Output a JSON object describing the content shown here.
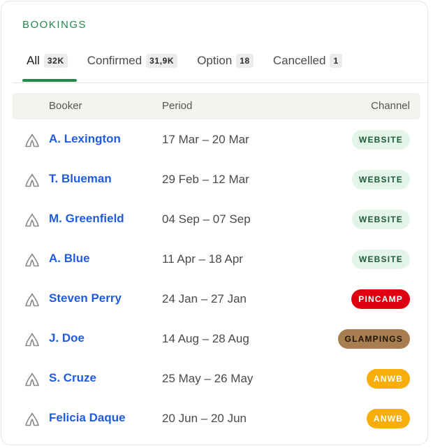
{
  "card": {
    "title": "BOOKINGS"
  },
  "tabs": [
    {
      "label": "All",
      "count": "32K",
      "active": true
    },
    {
      "label": "Confirmed",
      "count": "31,9K",
      "active": false
    },
    {
      "label": "Option",
      "count": "18",
      "active": false
    },
    {
      "label": "Cancelled",
      "count": "1",
      "active": false
    }
  ],
  "table": {
    "headers": {
      "booker": "Booker",
      "period": "Period",
      "channel": "Channel"
    },
    "rows": [
      {
        "icon": "tent-icon",
        "booker": "A. Lexington",
        "period": "17 Mar – 20 Mar",
        "channel": "WEBSITE"
      },
      {
        "icon": "tent-icon",
        "booker": "T. Blueman",
        "period": "29 Feb – 12 Mar",
        "channel": "WEBSITE"
      },
      {
        "icon": "tent-icon",
        "booker": "M. Greenfield",
        "period": "04 Sep – 07 Sep",
        "channel": "WEBSITE"
      },
      {
        "icon": "tent-icon",
        "booker": "A. Blue",
        "period": "11 Apr – 18 Apr",
        "channel": "WEBSITE"
      },
      {
        "icon": "tent-icon",
        "booker": "Steven Perry",
        "period": "24 Jan – 27 Jan",
        "channel": "PINCAMP"
      },
      {
        "icon": "tent-icon",
        "booker": "J. Doe",
        "period": "14 Aug – 28 Aug",
        "channel": "GLAMPINGS"
      },
      {
        "icon": "tent-icon",
        "booker": "S. Cruze",
        "period": "25 May – 26 May",
        "channel": "ANWB"
      },
      {
        "icon": "tent-icon",
        "booker": "Felicia Daque",
        "period": "20 Jun – 20 Jun",
        "channel": "ANWB"
      }
    ]
  },
  "colors": {
    "accent": "#1f8a4c",
    "link": "#1f5ce0",
    "website_bg": "#e3f4e9",
    "website_fg": "#1e5a36",
    "pincamp_bg": "#e0000f",
    "glampings_bg": "#a87d4f",
    "anwb_bg": "#f8ad0a"
  }
}
